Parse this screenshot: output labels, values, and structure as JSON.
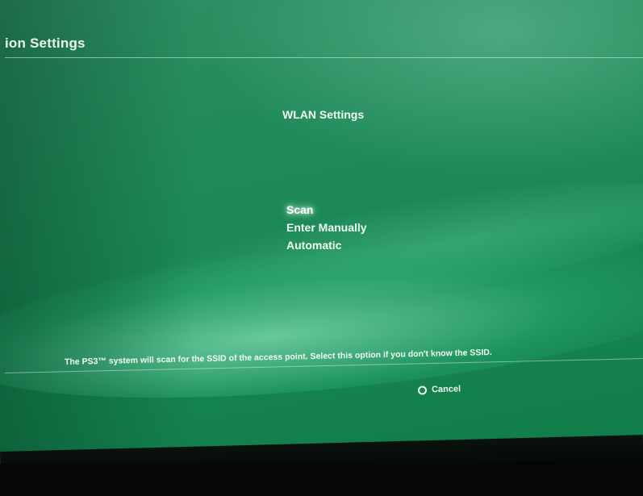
{
  "header": {
    "title": "ion Settings"
  },
  "dialog": {
    "title": "WLAN Settings",
    "options": [
      {
        "label": "Scan",
        "selected": true
      },
      {
        "label": "Enter Manually",
        "selected": false
      },
      {
        "label": "Automatic",
        "selected": false
      }
    ]
  },
  "footer": {
    "help_text": "The PS3™ system will scan for the SSID of the access point. Select this option if you don't know the SSID.",
    "cancel_icon": "circle-button-icon",
    "cancel_label": "Cancel"
  },
  "colors": {
    "background": "#1f8a58",
    "text": "#f2fbf6"
  }
}
